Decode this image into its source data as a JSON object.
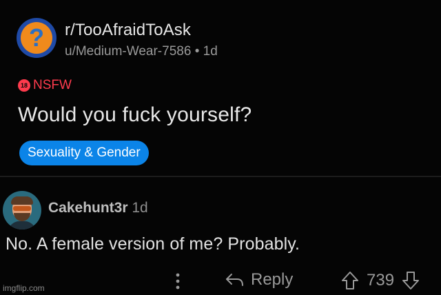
{
  "post": {
    "subreddit": "r/TooAfraidToAsk",
    "author": "u/Medium-Wear-7586",
    "age": "1d",
    "nsfw_badge": "18",
    "nsfw_label": "NSFW",
    "title": "Would you fuck yourself?",
    "flair": "Sexuality & Gender",
    "subreddit_icon_glyph": "?"
  },
  "comment": {
    "username": "Cakehunt3r",
    "age": "1d",
    "text": "No. A female version of me? Probably.",
    "reply_label": "Reply",
    "score": "739"
  },
  "watermark": "imgflip.com",
  "colors": {
    "background": "#050505",
    "nsfw": "#ff3b4d",
    "flair": "#0b84e8",
    "subreddit_icon": "#f08a1c"
  },
  "icons": [
    "question-mark-icon",
    "nsfw-18-icon",
    "more-dots-icon",
    "reply-arrow-icon",
    "upvote-icon",
    "downvote-icon"
  ]
}
